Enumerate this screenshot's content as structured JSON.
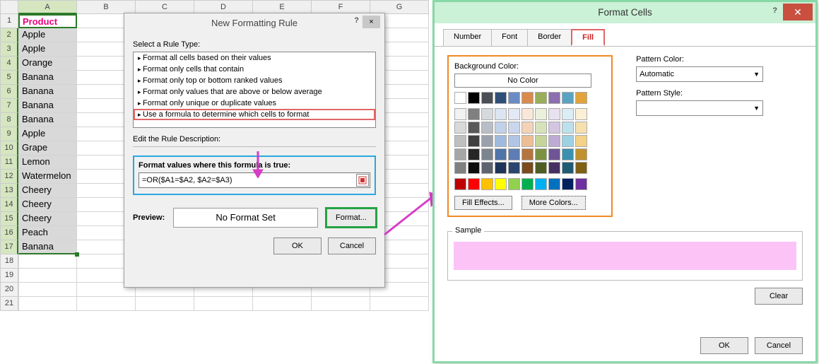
{
  "spreadsheet": {
    "columns": [
      "A",
      "B",
      "C",
      "D",
      "E",
      "F",
      "G"
    ],
    "selected_col_index": 0,
    "rows": [
      "Product",
      "Apple",
      "Apple",
      "Orange",
      "Banana",
      "Banana",
      "Banana",
      "Banana",
      "Apple",
      "Grape",
      "Lemon",
      "Watermelon",
      "Cheery",
      "Cheery",
      "Cheery",
      "Peach",
      "Banana"
    ],
    "extra_blank_rows": [
      "18",
      "19",
      "20",
      "21"
    ]
  },
  "dlg_rule": {
    "title": "New Formatting Rule",
    "help": "?",
    "close": "×",
    "select_label": "Select a Rule Type:",
    "rule_types": [
      "Format all cells based on their values",
      "Format only cells that contain",
      "Format only top or bottom ranked values",
      "Format only values that are above or below average",
      "Format only unique or duplicate values",
      "Use a formula to determine which cells to format"
    ],
    "selected_rule_index": 5,
    "edit_label": "Edit the Rule Description:",
    "formula_label": "Format values where this formula is true:",
    "formula_value": "=OR($A1=$A2, $A2=$A3)",
    "preview_label": "Preview:",
    "preview_text": "No Format Set",
    "format_btn": "Format...",
    "ok": "OK",
    "cancel": "Cancel"
  },
  "dlg_format": {
    "title": "Format Cells",
    "help": "?",
    "close": "✕",
    "tabs": [
      "Number",
      "Font",
      "Border",
      "Fill"
    ],
    "active_tab_index": 3,
    "bg_label": "Background Color:",
    "no_color": "No Color",
    "theme_row1": [
      "#ffffff",
      "#000000",
      "#4a4f55",
      "#2f4f78",
      "#6a8bc4",
      "#d98a4d",
      "#9aad5a",
      "#8b6fae",
      "#5aa2c1",
      "#e2a43a"
    ],
    "theme_grid": [
      [
        "#f2f2f2",
        "#808080",
        "#d6d9dd",
        "#dce5f1",
        "#e3e9f4",
        "#f9e8da",
        "#eaf0dc",
        "#e8e1ef",
        "#dceef5",
        "#fbefd6"
      ],
      [
        "#d9d9d9",
        "#595959",
        "#b9bec6",
        "#c1d1e8",
        "#c9d6ed",
        "#f3d3b8",
        "#d7e2ba",
        "#d3c6e1",
        "#bde0ec",
        "#f7e0af"
      ],
      [
        "#bfbfbf",
        "#404040",
        "#9aa1ac",
        "#a0bade",
        "#b0c4e6",
        "#edbe96",
        "#c5d599",
        "#bfaad4",
        "#9cd1e3",
        "#f3d187"
      ],
      [
        "#a6a6a6",
        "#262626",
        "#7c848f",
        "#4f75a9",
        "#5d7db4",
        "#b5753f",
        "#7d9241",
        "#6f5596",
        "#3a90ae",
        "#bf922f"
      ],
      [
        "#808080",
        "#0d0d0d",
        "#5d6470",
        "#1e3557",
        "#2a466f",
        "#7a4a20",
        "#4f5d23",
        "#463062",
        "#1f5b72",
        "#806015"
      ]
    ],
    "standard_colors": [
      "#c00000",
      "#ff0000",
      "#ffc000",
      "#ffff00",
      "#92d050",
      "#00b050",
      "#00b0f0",
      "#0070c0",
      "#002060",
      "#7030a0"
    ],
    "fill_effects": "Fill Effects...",
    "more_colors": "More Colors...",
    "pattern_color_label": "Pattern Color:",
    "pattern_color_value": "Automatic",
    "pattern_style_label": "Pattern Style:",
    "pattern_style_value": "",
    "sample_label": "Sample",
    "sample_color": "#fcc3f6",
    "clear": "Clear",
    "ok": "OK",
    "cancel": "Cancel"
  }
}
